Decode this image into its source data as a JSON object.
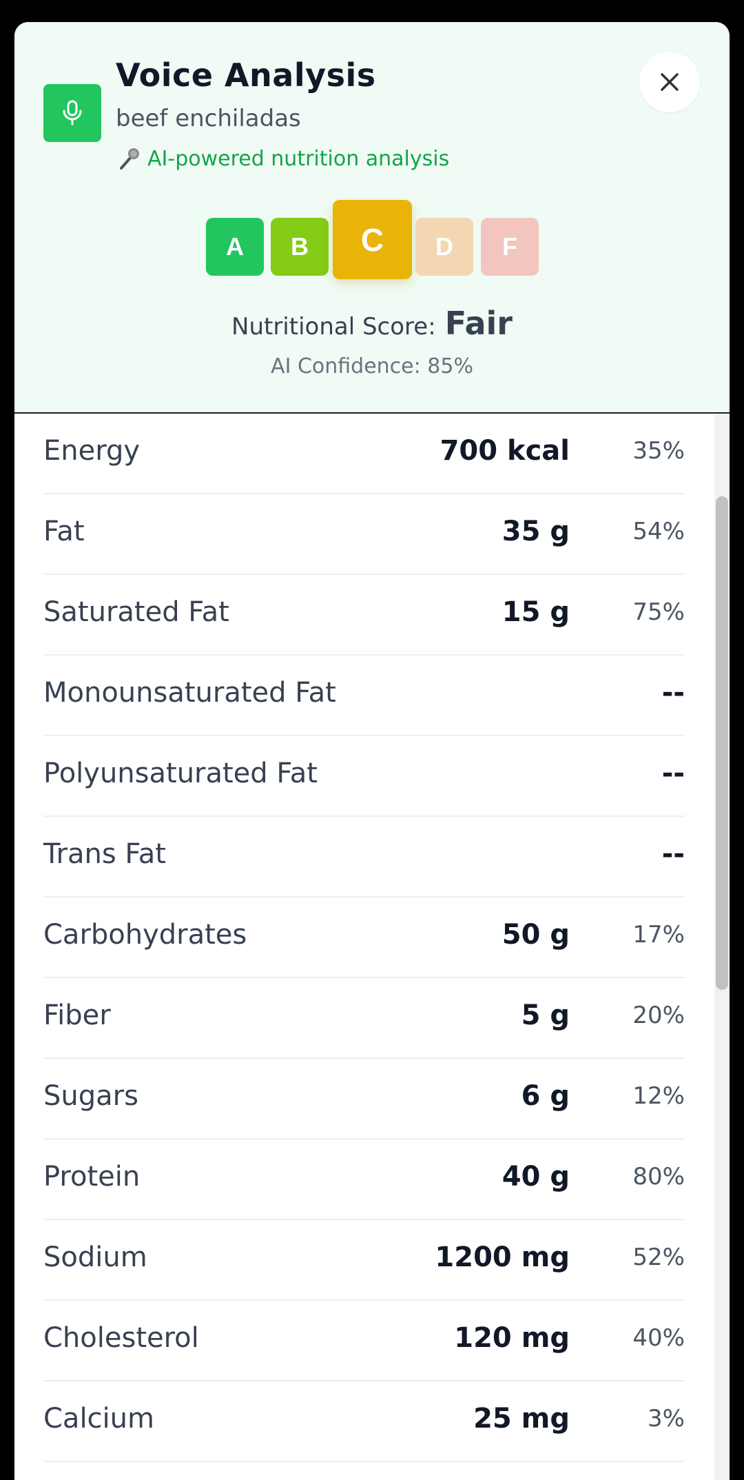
{
  "header": {
    "title": "Voice Analysis",
    "food_name": "beef enchiladas",
    "ai_tagline": "AI-powered nutrition analysis",
    "mic_icon": "microphone-icon",
    "close_icon": "close-icon",
    "background_color": "#effbf4",
    "accent_color": "#22c55e"
  },
  "nutri_score": {
    "grades": [
      {
        "letter": "A",
        "color": "#22c55e",
        "active": false
      },
      {
        "letter": "B",
        "color": "#84cc16",
        "active": false
      },
      {
        "letter": "C",
        "color": "#eab308",
        "active": true
      },
      {
        "letter": "D",
        "color": "#f3d6b2",
        "active": false
      },
      {
        "letter": "F",
        "color": "#f2c6bf",
        "active": false
      }
    ],
    "selected": "C",
    "label": "Nutritional Score:",
    "value": "Fair",
    "confidence_text": "AI Confidence: 85%"
  },
  "nutrients": [
    {
      "name": "Energy",
      "amount": "700 kcal",
      "dv": "35%"
    },
    {
      "name": "Fat",
      "amount": "35 g",
      "dv": "54%"
    },
    {
      "name": "Saturated Fat",
      "amount": "15 g",
      "dv": "75%"
    },
    {
      "name": "Monounsaturated Fat",
      "amount": "",
      "dv": "--"
    },
    {
      "name": "Polyunsaturated Fat",
      "amount": "",
      "dv": "--"
    },
    {
      "name": "Trans Fat",
      "amount": "",
      "dv": "--"
    },
    {
      "name": "Carbohydrates",
      "amount": "50 g",
      "dv": "17%"
    },
    {
      "name": "Fiber",
      "amount": "5 g",
      "dv": "20%"
    },
    {
      "name": "Sugars",
      "amount": "6 g",
      "dv": "12%"
    },
    {
      "name": "Protein",
      "amount": "40 g",
      "dv": "80%"
    },
    {
      "name": "Sodium",
      "amount": "1200 mg",
      "dv": "52%"
    },
    {
      "name": "Cholesterol",
      "amount": "120 mg",
      "dv": "40%"
    },
    {
      "name": "Calcium",
      "amount": "25 mg",
      "dv": "3%"
    }
  ]
}
